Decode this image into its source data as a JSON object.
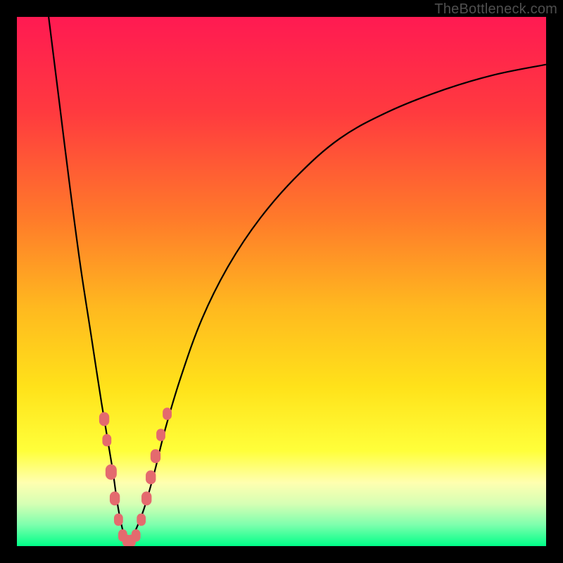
{
  "watermark": "TheBottleneck.com",
  "chart_data": {
    "type": "line",
    "title": "",
    "xlabel": "",
    "ylabel": "",
    "xlim": [
      0,
      100
    ],
    "ylim": [
      0,
      100
    ],
    "gradient_stops": [
      {
        "offset": 0,
        "color": "#ff1a52"
      },
      {
        "offset": 18,
        "color": "#ff3a3f"
      },
      {
        "offset": 38,
        "color": "#ff7a2a"
      },
      {
        "offset": 55,
        "color": "#ffb91f"
      },
      {
        "offset": 70,
        "color": "#ffe21a"
      },
      {
        "offset": 82,
        "color": "#ffff3a"
      },
      {
        "offset": 88,
        "color": "#ffffb0"
      },
      {
        "offset": 92,
        "color": "#d6ffb4"
      },
      {
        "offset": 96,
        "color": "#7dffad"
      },
      {
        "offset": 100,
        "color": "#00ff88"
      }
    ],
    "series": [
      {
        "name": "bottleneck-curve",
        "x": [
          6,
          8,
          10,
          12,
          14,
          16,
          18,
          19,
          20,
          21,
          22,
          24,
          26,
          28,
          31,
          35,
          40,
          46,
          53,
          61,
          70,
          80,
          90,
          100
        ],
        "y": [
          100,
          84,
          68,
          53,
          40,
          27,
          15,
          8,
          3,
          0,
          2,
          7,
          14,
          22,
          32,
          43,
          53,
          62,
          70,
          77,
          82,
          86,
          89,
          91
        ]
      }
    ],
    "markers": {
      "name": "highlighted-points",
      "color": "#e46a6e",
      "points": [
        {
          "x": 16.5,
          "y": 24,
          "r": 9
        },
        {
          "x": 17.0,
          "y": 20,
          "r": 8
        },
        {
          "x": 17.8,
          "y": 14,
          "r": 10
        },
        {
          "x": 18.5,
          "y": 9,
          "r": 9
        },
        {
          "x": 19.2,
          "y": 5,
          "r": 8
        },
        {
          "x": 20.0,
          "y": 2,
          "r": 8
        },
        {
          "x": 20.8,
          "y": 1,
          "r": 8
        },
        {
          "x": 21.6,
          "y": 1,
          "r": 8
        },
        {
          "x": 22.5,
          "y": 2,
          "r": 8
        },
        {
          "x": 23.5,
          "y": 5,
          "r": 8
        },
        {
          "x": 24.5,
          "y": 9,
          "r": 9
        },
        {
          "x": 25.3,
          "y": 13,
          "r": 9
        },
        {
          "x": 26.2,
          "y": 17,
          "r": 9
        },
        {
          "x": 27.2,
          "y": 21,
          "r": 8
        },
        {
          "x": 28.4,
          "y": 25,
          "r": 8
        }
      ]
    }
  }
}
